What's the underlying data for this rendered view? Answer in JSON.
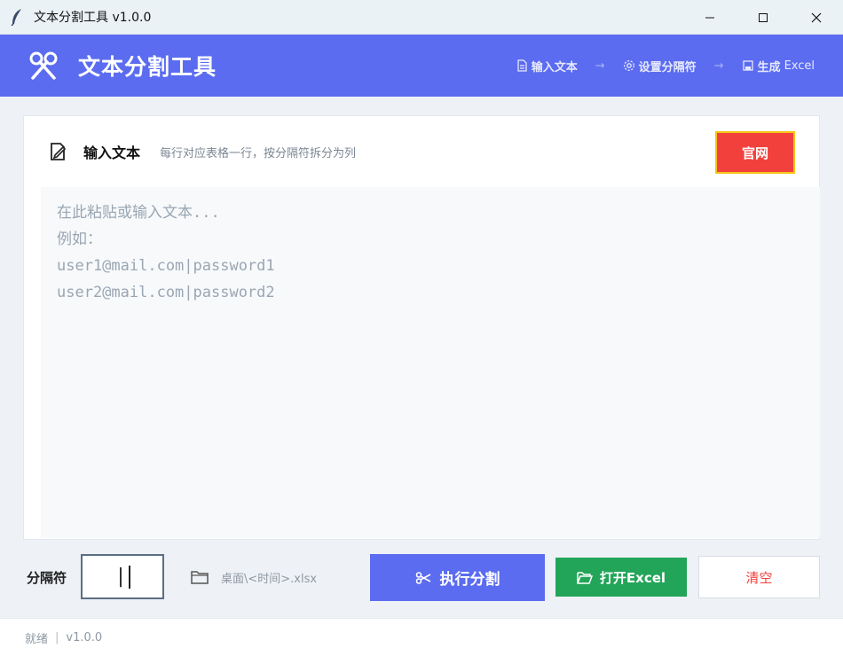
{
  "window": {
    "title": "文本分割工具 v1.0.0"
  },
  "header": {
    "app_title": "文本分割工具",
    "steps": [
      {
        "label": "输入文本",
        "icon": "document-icon"
      },
      {
        "label": "设置分隔符",
        "icon": "gear-icon"
      },
      {
        "label": "生成",
        "suffix": "Excel",
        "icon": "save-icon"
      }
    ],
    "step_arrow": "→",
    "accent_color": "#5b6cf0"
  },
  "card": {
    "title": "输入文本",
    "subtitle": "每行对应表格一行，按分隔符拆分为列",
    "site_button": "官网",
    "placeholder": "在此粘贴或输入文本...\n例如：\nuser1@mail.com|password1\nuser2@mail.com|password2"
  },
  "controls": {
    "separator_label": "分隔符",
    "separator_value": "|",
    "output_path": "桌面\\<时间>.xlsx",
    "execute_button": "执行分割",
    "open_button": "打开Excel",
    "clear_button": "清空"
  },
  "status": {
    "text": "就绪",
    "separator": "|",
    "version": "v1.0.0"
  }
}
